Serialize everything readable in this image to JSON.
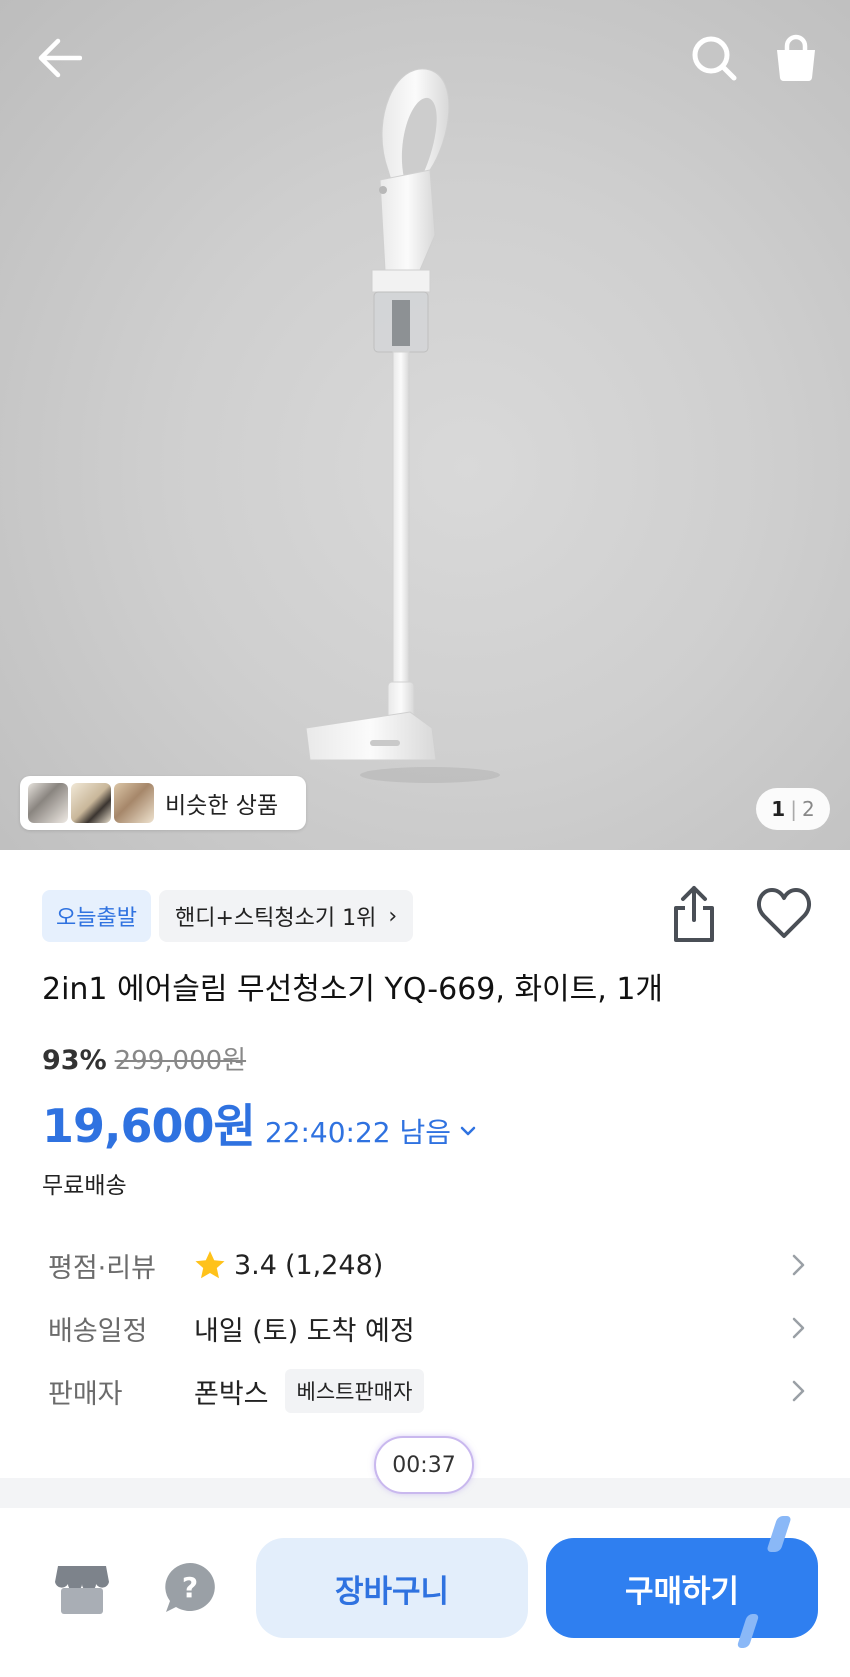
{
  "header": {
    "back_icon": "arrow-left-icon",
    "search_icon": "search-icon",
    "cart_icon": "shopping-bag-icon"
  },
  "gallery": {
    "similar_label": "비슷한 상품",
    "page_current": "1",
    "page_separator": "|",
    "page_total": "2"
  },
  "badges": {
    "delivery_badge": "오늘출발",
    "rank_badge": "핸디+스틱청소기 1위",
    "rank_chevron": "›"
  },
  "product": {
    "title": "2in1 에어슬림 무선청소기 YQ-669, 화이트, 1개",
    "discount": "93%",
    "original_price": "299,000원",
    "price": "19,600원",
    "timer": "22:40:22 남음",
    "shipping": "무료배송"
  },
  "info_rows": [
    {
      "label": "평점·리뷰",
      "rating": "3.4",
      "reviews": "(1,248)"
    },
    {
      "label": "배송일정",
      "value": "내일 (토) 도착 예정"
    },
    {
      "label": "판매자",
      "value": "폰박스",
      "badge": "베스트판매자"
    }
  ],
  "video_timer": "00:37",
  "actions": {
    "cart_button": "장바구니",
    "buy_button": "구매하기"
  },
  "colors": {
    "accent": "#2f72e0",
    "buy_button": "#2f7ff0",
    "cart_button_bg": "#e3eefb",
    "star": "#ffc21a"
  }
}
